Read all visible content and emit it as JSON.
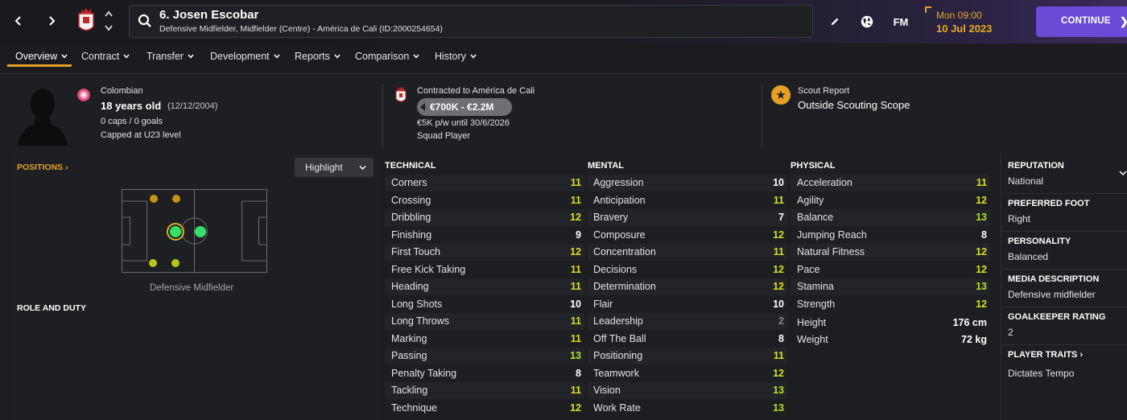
{
  "header": {
    "player_title": "6. Josen Escobar",
    "player_subtitle": "Defensive Midfielder, Midfielder (Centre) - América de Cali (ID:2000254654)",
    "fm_label": "FM",
    "time": "Mon 09:00",
    "date": "10 Jul 2023",
    "continue_label": "CONTINUE"
  },
  "tabs": [
    {
      "label": "Overview"
    },
    {
      "label": "Contract"
    },
    {
      "label": "Transfer"
    },
    {
      "label": "Development"
    },
    {
      "label": "Reports"
    },
    {
      "label": "Comparison"
    },
    {
      "label": "History"
    }
  ],
  "profile": {
    "nationality": "Colombian",
    "age": "18 years old",
    "dob": "(12/12/2004)",
    "caps": "0 caps / 0 goals",
    "capped": "Capped at U23 level"
  },
  "contract": {
    "contracted_to": "Contracted to América de Cali",
    "value": "€700K - €2.2M",
    "wage": "€5K p/w until 30/6/2026",
    "status": "Squad Player"
  },
  "scout": {
    "label": "Scout Report",
    "value": "Outside Scouting Scope"
  },
  "positions": {
    "link_label": "POSITIONS",
    "highlight_label": "Highlight",
    "position_label": "Defensive Midfielder",
    "role_duty_label": "ROLE AND DUTY"
  },
  "attributes": {
    "technical_title": "TECHNICAL",
    "mental_title": "MENTAL",
    "physical_title": "PHYSICAL",
    "technical": [
      {
        "name": "Corners",
        "value": "11"
      },
      {
        "name": "Crossing",
        "value": "11"
      },
      {
        "name": "Dribbling",
        "value": "12"
      },
      {
        "name": "Finishing",
        "value": "9"
      },
      {
        "name": "First Touch",
        "value": "12"
      },
      {
        "name": "Free Kick Taking",
        "value": "11"
      },
      {
        "name": "Heading",
        "value": "11"
      },
      {
        "name": "Long Shots",
        "value": "10"
      },
      {
        "name": "Long Throws",
        "value": "11"
      },
      {
        "name": "Marking",
        "value": "11"
      },
      {
        "name": "Passing",
        "value": "13"
      },
      {
        "name": "Penalty Taking",
        "value": "8"
      },
      {
        "name": "Tackling",
        "value": "11"
      },
      {
        "name": "Technique",
        "value": "12"
      }
    ],
    "mental": [
      {
        "name": "Aggression",
        "value": "10"
      },
      {
        "name": "Anticipation",
        "value": "11"
      },
      {
        "name": "Bravery",
        "value": "7"
      },
      {
        "name": "Composure",
        "value": "12"
      },
      {
        "name": "Concentration",
        "value": "11"
      },
      {
        "name": "Decisions",
        "value": "12"
      },
      {
        "name": "Determination",
        "value": "12"
      },
      {
        "name": "Flair",
        "value": "10"
      },
      {
        "name": "Leadership",
        "value": "2"
      },
      {
        "name": "Off The Ball",
        "value": "8"
      },
      {
        "name": "Positioning",
        "value": "11"
      },
      {
        "name": "Teamwork",
        "value": "12"
      },
      {
        "name": "Vision",
        "value": "13"
      },
      {
        "name": "Work Rate",
        "value": "13"
      }
    ],
    "physical": [
      {
        "name": "Acceleration",
        "value": "11"
      },
      {
        "name": "Agility",
        "value": "12"
      },
      {
        "name": "Balance",
        "value": "13"
      },
      {
        "name": "Jumping Reach",
        "value": "8"
      },
      {
        "name": "Natural Fitness",
        "value": "12"
      },
      {
        "name": "Pace",
        "value": "12"
      },
      {
        "name": "Stamina",
        "value": "13"
      },
      {
        "name": "Strength",
        "value": "12"
      }
    ],
    "height_label": "Height",
    "height_value": "176 cm",
    "weight_label": "Weight",
    "weight_value": "72 kg"
  },
  "info": {
    "reputation_label": "REPUTATION",
    "reputation_value": "National",
    "foot_label": "PREFERRED FOOT",
    "foot_value": "Right",
    "personality_label": "PERSONALITY",
    "personality_value": "Balanced",
    "media_label": "MEDIA DESCRIPTION",
    "media_value": "Defensive midfielder",
    "gk_label": "GOALKEEPER RATING",
    "gk_value": "2",
    "traits_label": "PLAYER TRAITS",
    "traits_value": "Dictates Tempo"
  },
  "colors": {
    "accent": "#e6a125",
    "continue": "#6a4bd6",
    "attr_yellow": "#d8e01f",
    "attr_green": "#b5dd2a"
  }
}
